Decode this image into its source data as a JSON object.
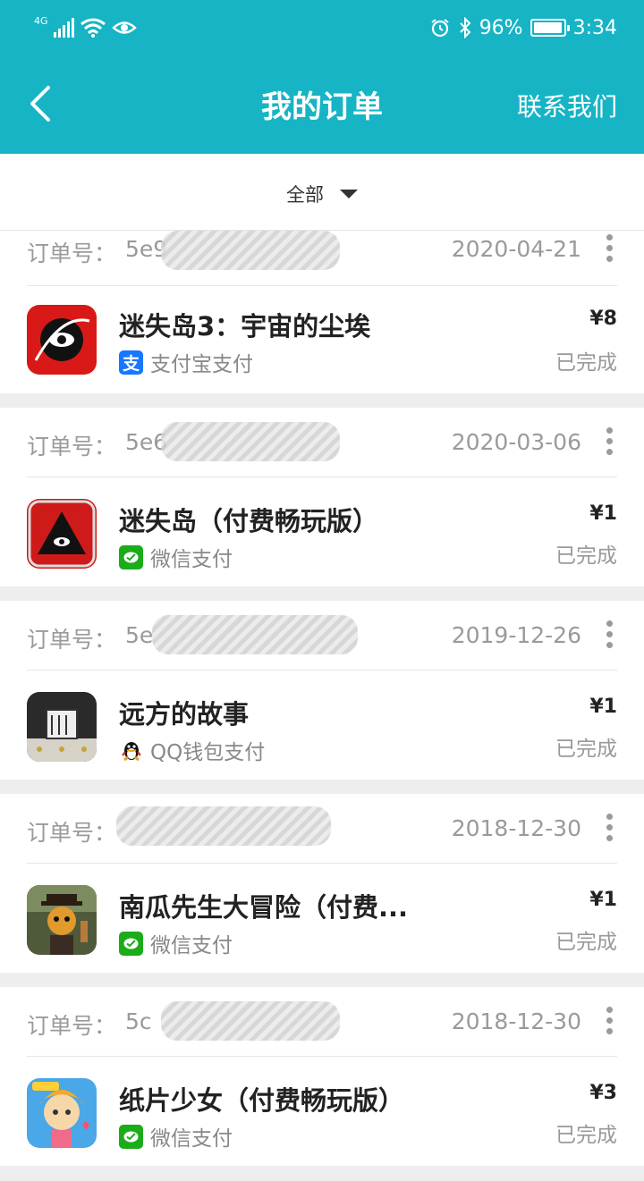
{
  "status_bar": {
    "network": "4G",
    "battery_percent": "96%",
    "time": "3:34"
  },
  "header": {
    "title": "我的订单",
    "contact_label": "联系我们"
  },
  "filter": {
    "selected": "全部"
  },
  "orders": [
    {
      "order_label": "订单号：",
      "order_id_partial": "5e9",
      "date": "2020-04-21",
      "game_name": "迷失岛3：宇宙的尘埃",
      "payment_method": "支付宝支付",
      "payment_icon": "alipay-icon",
      "price": "¥8",
      "status": "已完成"
    },
    {
      "order_label": "订单号：",
      "order_id_partial": "5e6",
      "date": "2020-03-06",
      "game_name": "迷失岛（付费畅玩版）",
      "payment_method": "微信支付",
      "payment_icon": "wechat-pay-icon",
      "price": "¥1",
      "status": "已完成"
    },
    {
      "order_label": "订单号：",
      "order_id_partial": "5e",
      "date": "2019-12-26",
      "game_name": "远方的故事",
      "payment_method": "QQ钱包支付",
      "payment_icon": "qq-wallet-icon",
      "price": "¥1",
      "status": "已完成"
    },
    {
      "order_label": "订单号：",
      "order_id_partial": "",
      "date": "2018-12-30",
      "game_name": "南瓜先生大冒险（付费...",
      "payment_method": "微信支付",
      "payment_icon": "wechat-pay-icon",
      "price": "¥1",
      "status": "已完成"
    },
    {
      "order_label": "订单号：",
      "order_id_partial": "5c",
      "date": "2018-12-30",
      "game_name": "纸片少女（付费畅玩版）",
      "payment_method": "微信支付",
      "payment_icon": "wechat-pay-icon",
      "price": "¥3",
      "status": "已完成"
    }
  ],
  "colors": {
    "brand_teal": "#16b4c5",
    "alipay_blue": "#1677ff",
    "wechat_green": "#1aad19"
  }
}
